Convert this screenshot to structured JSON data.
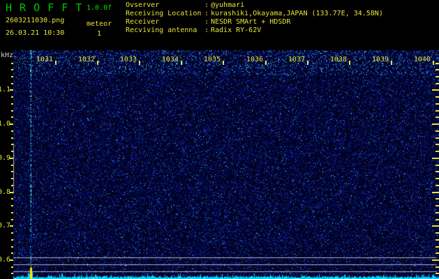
{
  "header": {
    "app_title": "H R O F F T",
    "version": "1.0.0f",
    "filename": "2603211030.png",
    "mode": "meteor",
    "datetime": "26.03.21 10:30",
    "count": "1",
    "separator": ":",
    "info_rows": [
      {
        "label": "Ovserver",
        "value": "@yuhmari"
      },
      {
        "label": "Receiving Location",
        "value": "kurashiki,Okayama,JAPAN (133.77E, 34.58N)"
      },
      {
        "label": "Receiver",
        "value": "NESDR SMArt + HDSDR"
      },
      {
        "label": "Recviving antenna",
        "value": "Radix RY-62V"
      }
    ]
  },
  "chart_data": {
    "type": "heatmap",
    "title": "HROFFT 10-minute meteor-radio spectrogram (background noise only, no echoes)",
    "ylabel": "kHz",
    "xlabel": "",
    "x_tick_labels": [
      "1031",
      "1032",
      "1033",
      "1034",
      "1035",
      "1036",
      "1037",
      "1038",
      "1039",
      "1040"
    ],
    "xlim": [
      1030,
      1040
    ],
    "y_tick_labels": [
      "1.1",
      "1.0",
      "0.9",
      "0.8",
      "0.7",
      "0.6"
    ],
    "y_tick_values": [
      1.1,
      1.0,
      0.9,
      0.8,
      0.7,
      0.6
    ],
    "y_minor_step": 0.02,
    "ylim": [
      0.55,
      1.21
    ],
    "grid": "off",
    "legend": "none",
    "carrier_line": {
      "time": 1030.4,
      "freq_span": [
        0.56,
        1.21
      ]
    },
    "horizontal_marker_freqs": [
      0.608,
      0.588,
      0.567
    ],
    "left_marker_bar_freq_span": [
      0.797,
      0.943
    ],
    "signal_strip": {
      "description": "cyan audio-level strip along bottom edge",
      "spike_time": 1030.4
    }
  },
  "colors": {
    "background": "#000000",
    "label_yellow": "#e8e438",
    "title_green": "#00c400",
    "version_green": "#00dc00",
    "axis_white": "#d4d4d4",
    "marker_gray": "#b2b2b2",
    "noise_blue": "#1830a0",
    "sparkle_cyan": "#40d0ff",
    "strip_cyan": "#00d8f8",
    "spike_yellow": "#ffe400"
  }
}
